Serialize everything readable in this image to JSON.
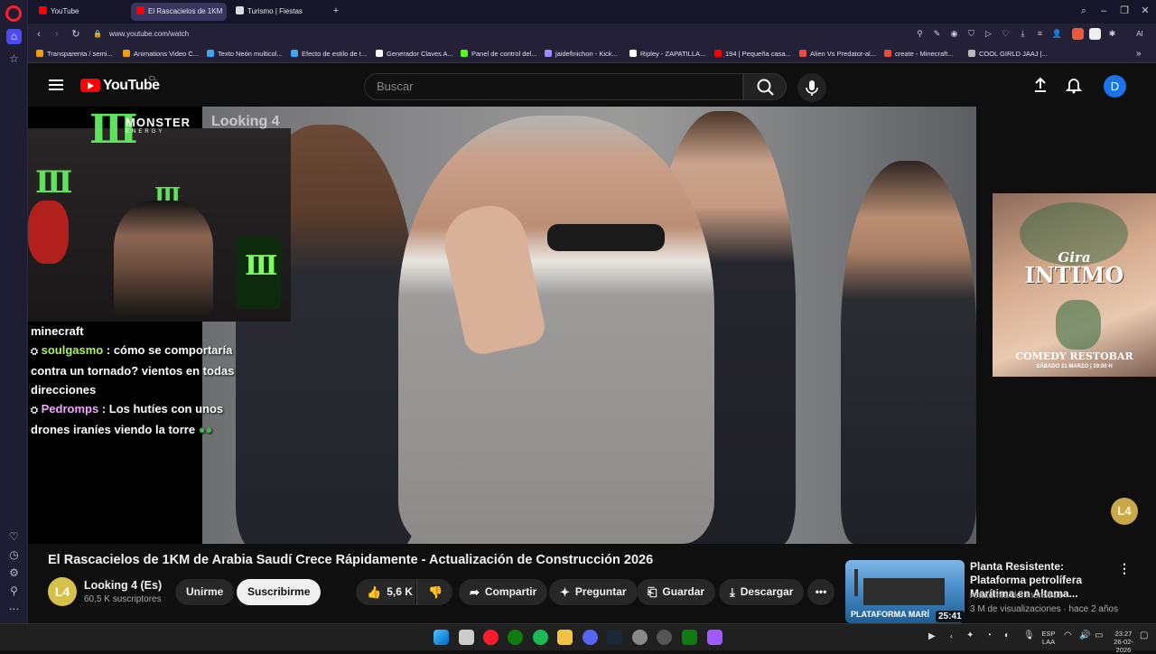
{
  "browser": {
    "tabs": [
      {
        "label": "YouTube",
        "color": "#ff0000"
      },
      {
        "label": "El Rascacielos de 1KM",
        "color": "#ff0000"
      },
      {
        "label": "Turismo | Fiestas",
        "color": "#dddddd"
      }
    ],
    "url": "www.youtube.com/watch",
    "bookmarks": [
      {
        "label": "Transparenta / semi...",
        "color": "#f39c12"
      },
      {
        "label": "Animations Video C...",
        "color": "#f39c12"
      },
      {
        "label": "Texto Neón multicol...",
        "color": "#3da5f5"
      },
      {
        "label": "Efecto de estilo de t...",
        "color": "#3da5f5"
      },
      {
        "label": "Generador Claves A...",
        "color": "#ffffff"
      },
      {
        "label": "Panel de control del...",
        "color": "#53fc18"
      },
      {
        "label": "jaidefinichon - Kick...",
        "color": "#9b8cff"
      },
      {
        "label": "Ripley - ZAPATILLA...",
        "color": "#ffffff"
      },
      {
        "label": "194 | Pequeña casa...",
        "color": "#ff0000"
      },
      {
        "label": "Alien Vs Predator-al...",
        "color": "#e74c3c"
      },
      {
        "label": "create - Minecraft...",
        "color": "#e74c3c"
      },
      {
        "label": "COOL GIRLD JAAJ |...",
        "color": "#bbbbbb"
      }
    ]
  },
  "header": {
    "logo_text": "YouTube",
    "country_code": "CL",
    "search_placeholder": "Buscar",
    "avatar_letter": "D"
  },
  "video": {
    "overlay_brand": "MONSTER",
    "overlay_brand_sub": "ENERGY",
    "watermark": "Looking 4",
    "chat": [
      {
        "user": "",
        "message": "minecraft"
      },
      {
        "user": "soulgasmo",
        "message": ": cómo se comportaría contra un tornado? vientos en todas direcciones"
      },
      {
        "user": "Pedromps",
        "message": ": Los hutíes con unos drones iraníes viendo la torre"
      }
    ],
    "poster": {
      "title1": "Gira",
      "title2": "INTIMO",
      "venue": "COMEDY RESTOBAR",
      "date": "SÁBADO 21 MARZO | 19:00 H"
    },
    "badge": "L4"
  },
  "meta": {
    "title": "El Rascacielos de 1KM de Arabia Saudí Crece Rápidamente - Actualización de Construcción 2026",
    "channel_name": "Looking 4 (Es)",
    "channel_avatar": "L4",
    "subscribers": "60,5 K suscriptores",
    "join_label": "Unirme",
    "subscribe_label": "Suscribirme",
    "likes": "5,6 K",
    "share_label": "Compartir",
    "ask_label": "Preguntar",
    "save_label": "Guardar",
    "download_label": "Descargar"
  },
  "suggestion": {
    "title": "Planta Resistente: Plataforma petrolífera Marítima en Altama...",
    "channel": "Anatomía del monstruo",
    "meta": "3 M de visualizaciones · hace 2 años",
    "duration": "25:41",
    "thumb_caption": "PLATAFORMA MARÍ"
  },
  "taskbar": {
    "lang": "ESP",
    "region": "LAA",
    "time": "23:27",
    "date": "26-02-2026"
  }
}
